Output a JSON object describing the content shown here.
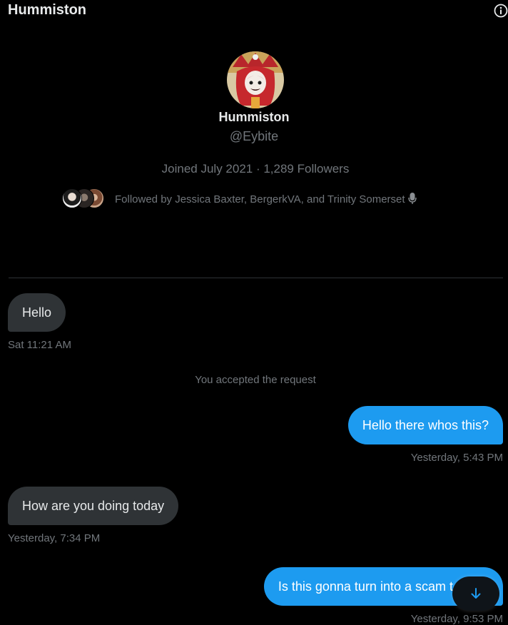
{
  "header": {
    "title": "Hummiston"
  },
  "profile": {
    "name": "Hummiston",
    "handle": "@Eybite",
    "joined": "Joined July 2021",
    "separator": " · ",
    "followers": "1,289 Followers",
    "followed_by": "Followed by Jessica Baxter, BergerkVA, and Trinity Somerset"
  },
  "messages": [
    {
      "direction": "incoming",
      "text": "Hello",
      "time": "Sat 11:21 AM"
    },
    {
      "direction": "system",
      "text": "You accepted the request"
    },
    {
      "direction": "outgoing",
      "text": "Hello there whos this?",
      "time": "Yesterday, 5:43 PM"
    },
    {
      "direction": "incoming",
      "text": "How are you doing today",
      "time": "Yesterday, 7:34 PM"
    },
    {
      "direction": "outgoing",
      "text": "Is this gonna turn into a scam t",
      "time": "Yesterday, 9:53 PM"
    }
  ],
  "colors": {
    "background": "#000000",
    "incoming_bubble": "#2f3336",
    "outgoing_bubble": "#1d9bf0",
    "muted_text": "#71767b",
    "primary_text": "#e7e9ea"
  },
  "icons": {
    "info": "info-icon",
    "avatar": "avatar",
    "mic": "microphone-icon",
    "scroll": "arrow-down-icon"
  }
}
